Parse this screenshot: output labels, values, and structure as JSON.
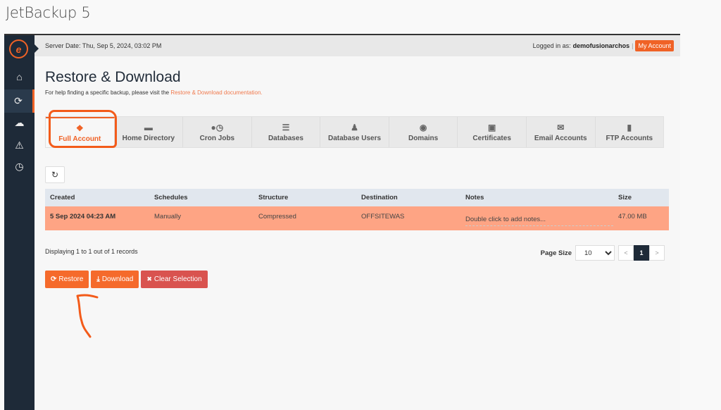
{
  "window_title": "JetBackup 5",
  "topbar": {
    "server_date": "Server Date: Thu, Sep 5, 2024, 03:02 PM",
    "logged_in_prefix": "Logged in as:",
    "username": "demofusionarchos",
    "separator": "|",
    "my_account_label": "My Account"
  },
  "sidebar": {
    "items": [
      {
        "name": "dashboard",
        "icon": "home-icon",
        "glyph": "🏠"
      },
      {
        "name": "restore-download",
        "icon": "sync-icon",
        "glyph": "⟳",
        "active": true
      },
      {
        "name": "downloads",
        "icon": "cloud-download-icon",
        "glyph": "☁"
      },
      {
        "name": "alerts",
        "icon": "warning-icon",
        "glyph": "⚠"
      },
      {
        "name": "queue",
        "icon": "clock-icon",
        "glyph": "🕒"
      }
    ]
  },
  "page": {
    "title": "Restore & Download",
    "help_text": "For help finding a specific backup, please visit the ",
    "help_link": "Restore & Download documentation."
  },
  "tabs": [
    {
      "label": "Full Account",
      "icon": "cubes-icon",
      "glyph": "❖",
      "active": true
    },
    {
      "label": "Home Directory",
      "icon": "folder-icon",
      "glyph": "▬"
    },
    {
      "label": "Cron Jobs",
      "icon": "user-clock-icon",
      "glyph": "👤"
    },
    {
      "label": "Databases",
      "icon": "database-icon",
      "glyph": "≣"
    },
    {
      "label": "Database Users",
      "icon": "user-tie-icon",
      "glyph": "👤"
    },
    {
      "label": "Domains",
      "icon": "map-marker-icon",
      "glyph": "⬤"
    },
    {
      "label": "Certificates",
      "icon": "lock-icon",
      "glyph": "🔒"
    },
    {
      "label": "Email Accounts",
      "icon": "envelope-icon",
      "glyph": "✉"
    },
    {
      "label": "FTP Accounts",
      "icon": "file-icon",
      "glyph": "▮"
    }
  ],
  "refresh_glyph": "↻",
  "table": {
    "columns": [
      "Created",
      "Schedules",
      "Structure",
      "Destination",
      "Notes",
      "Size"
    ],
    "rows": [
      {
        "created": "5 Sep 2024 04:23 AM",
        "schedules": "Manually",
        "structure": "Compressed",
        "destination": "OFFSITEWAS",
        "notes": "Double click to add notes...",
        "size": "47.00 MB",
        "selected": true
      }
    ]
  },
  "footer": {
    "records_text": "Displaying 1 to 1 out of 1 records",
    "page_size_label": "Page Size",
    "page_size_value": "10",
    "prev": "<",
    "current_page": "1",
    "next": ">"
  },
  "actions": {
    "restore": {
      "label": "Restore",
      "glyph": "⟳"
    },
    "download": {
      "label": "Download",
      "glyph": "⤓"
    },
    "clear": {
      "label": "Clear Selection",
      "glyph": "✖"
    }
  },
  "colors": {
    "accent": "#f06226",
    "sidebar": "#1e2a38",
    "selected_row": "#fea484",
    "danger": "#d9534f"
  }
}
